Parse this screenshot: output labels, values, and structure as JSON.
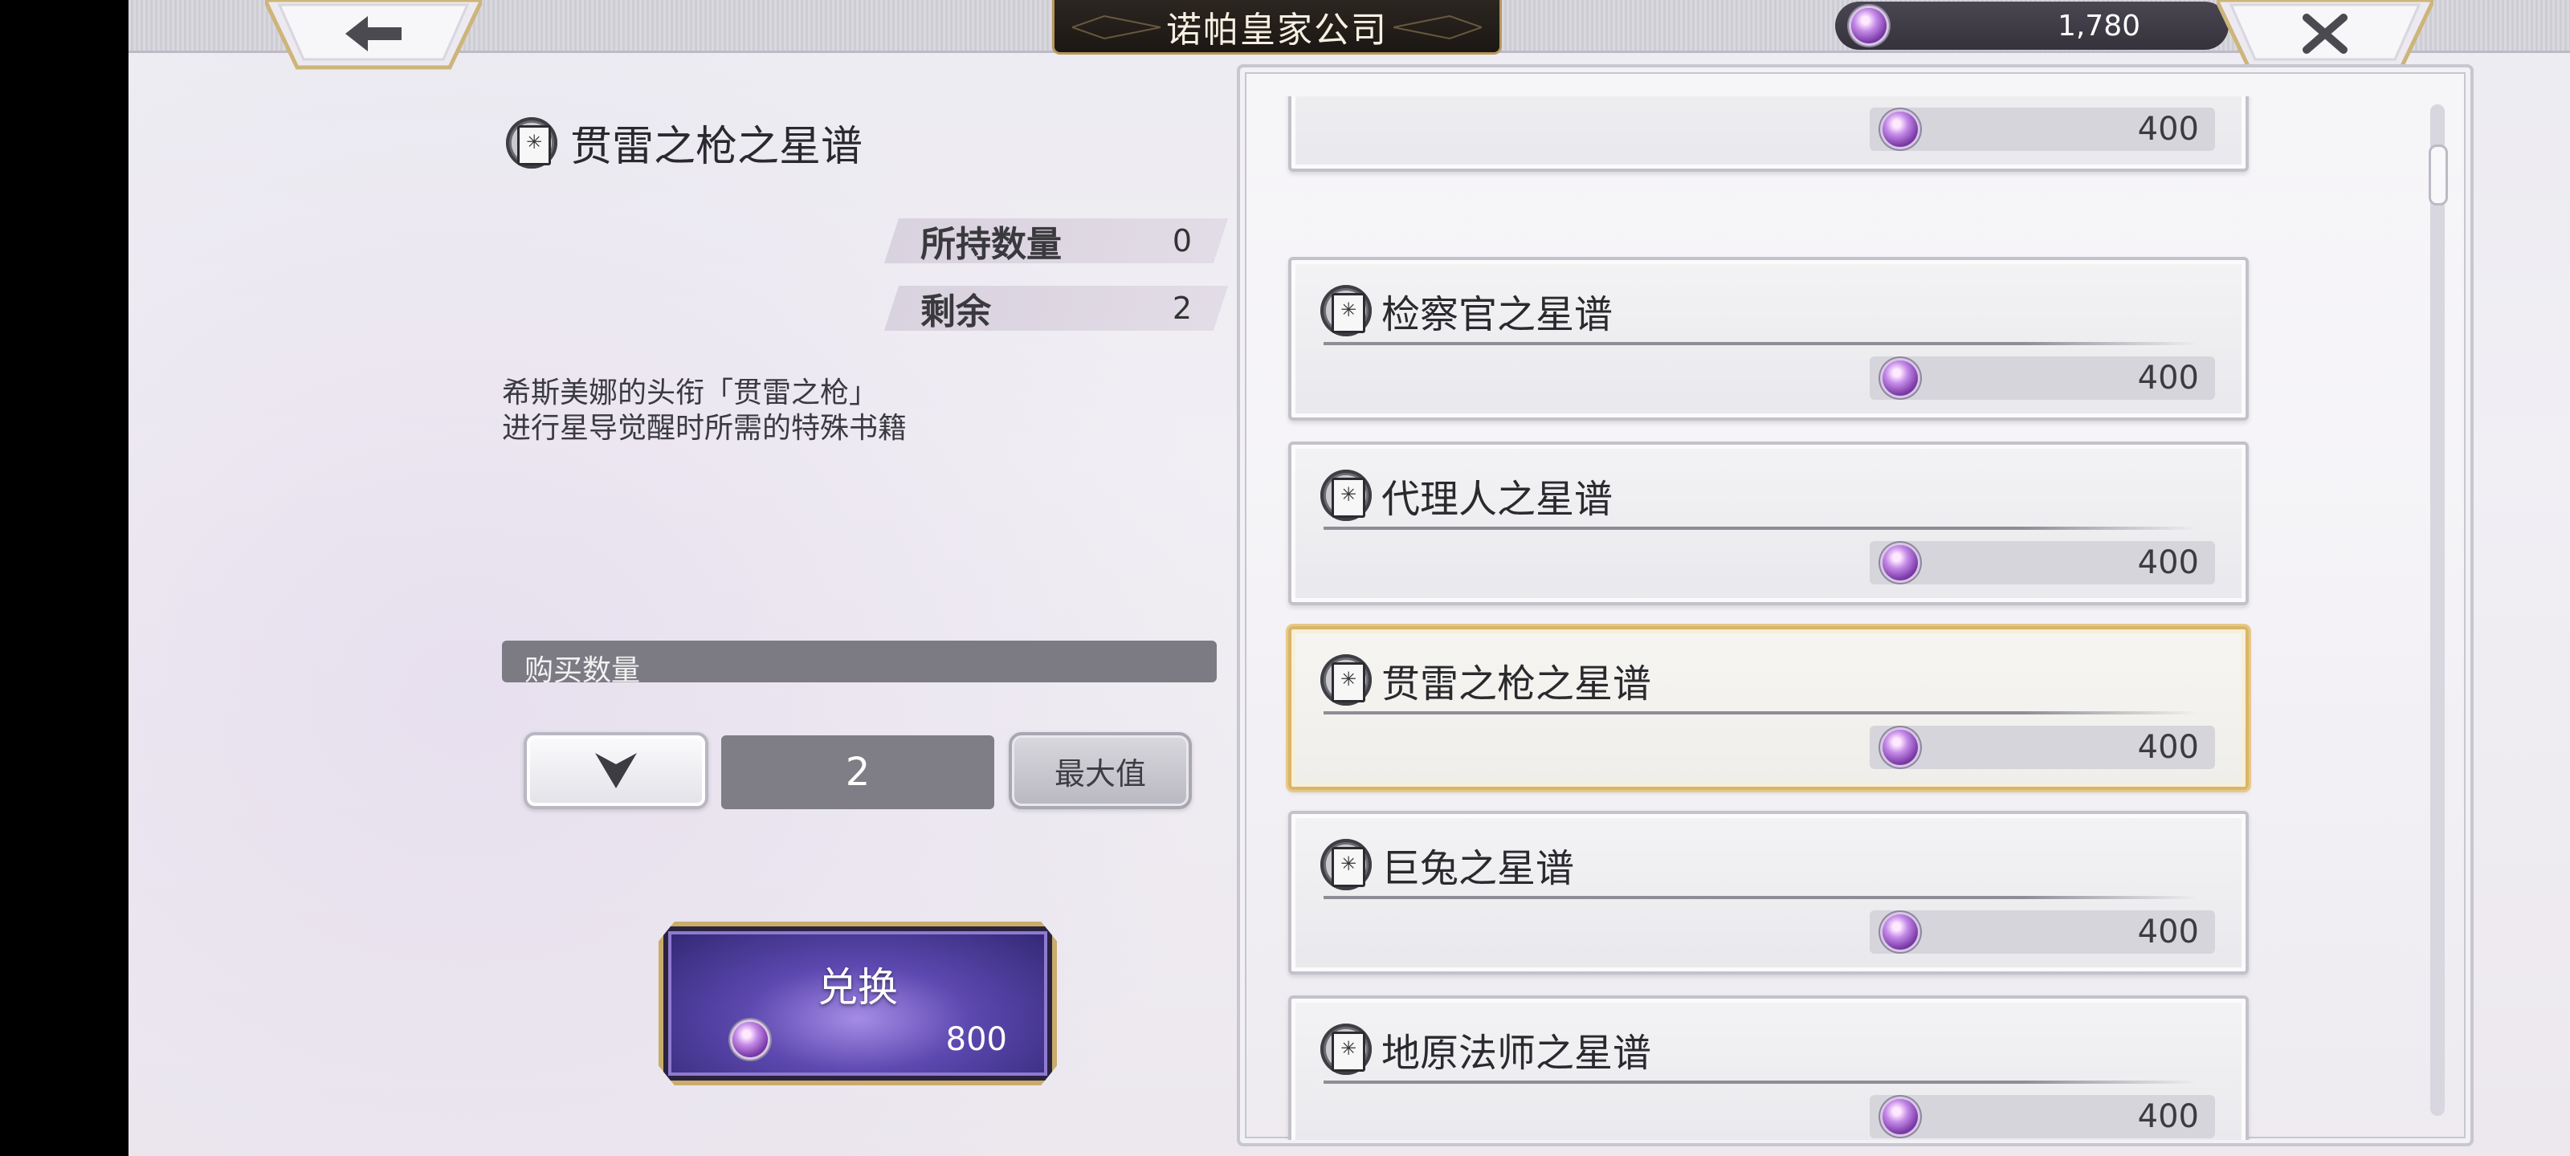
{
  "header": {
    "title": "诺帕皇家公司",
    "currency_amount": "1,780",
    "back_icon": "arrow-left",
    "close_icon": "x"
  },
  "detail": {
    "item_name": "贯雷之枪之星谱",
    "held_label": "所持数量",
    "held_value": "0",
    "remain_label": "剩余",
    "remain_value": "2",
    "description_lines": [
      "希斯美娜的头衔「贯雷之枪」",
      "进行星导觉醒时所需的特殊书籍"
    ]
  },
  "purchase": {
    "quantity_label": "购买数量",
    "quantity": "2",
    "max_label": "最大值",
    "exchange_label": "兑换",
    "exchange_cost": "800"
  },
  "shop_list": {
    "items": [
      {
        "name": "",
        "price": "400",
        "selected": false
      },
      {
        "name": "检察官之星谱",
        "price": "400",
        "selected": false
      },
      {
        "name": "代理人之星谱",
        "price": "400",
        "selected": false
      },
      {
        "name": "贯雷之枪之星谱",
        "price": "400",
        "selected": true
      },
      {
        "name": "巨兔之星谱",
        "price": "400",
        "selected": false
      },
      {
        "name": "地原法师之星谱",
        "price": "400",
        "selected": false
      }
    ]
  },
  "colors": {
    "gold_accent": "#d9b56a",
    "exchange_purple": "#5d49b0",
    "field_gray": "#7f7d86"
  }
}
